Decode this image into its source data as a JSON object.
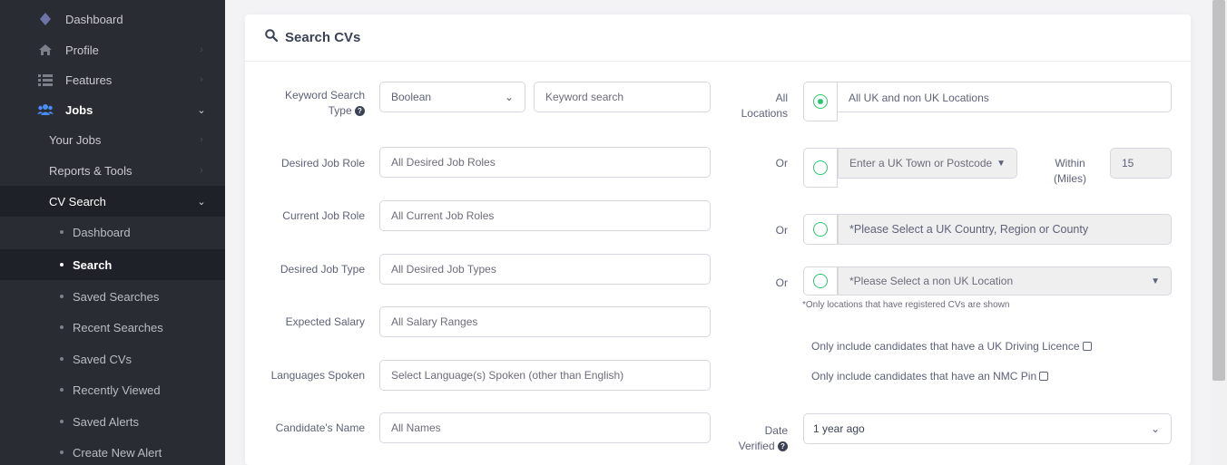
{
  "sidebar": {
    "items": [
      {
        "label": "Dashboard",
        "icon": "diamond-icon"
      },
      {
        "label": "Profile",
        "icon": "home-icon"
      },
      {
        "label": "Features",
        "icon": "list-icon"
      },
      {
        "label": "Jobs",
        "icon": "users-icon"
      },
      {
        "label": "Your Jobs"
      },
      {
        "label": "Reports & Tools"
      },
      {
        "label": "CV Search"
      }
    ],
    "sub_items": [
      {
        "label": "Dashboard"
      },
      {
        "label": "Search"
      },
      {
        "label": "Saved Searches"
      },
      {
        "label": "Recent Searches"
      },
      {
        "label": "Saved CVs"
      },
      {
        "label": "Recently Viewed"
      },
      {
        "label": "Saved Alerts"
      },
      {
        "label": "Create New Alert"
      }
    ],
    "active_sub": "Search"
  },
  "card": {
    "title": "Search CVs"
  },
  "form": {
    "keyword_type_label": "Keyword Search Type",
    "keyword_type_value": "Boolean",
    "keyword_placeholder": "Keyword search",
    "desired_job_role_label": "Desired Job Role",
    "desired_job_role_placeholder": "All Desired Job Roles",
    "current_job_role_label": "Current Job Role",
    "current_job_role_placeholder": "All Current Job Roles",
    "desired_job_type_label": "Desired Job Type",
    "desired_job_type_placeholder": "All Desired Job Types",
    "expected_salary_label": "Expected Salary",
    "expected_salary_placeholder": "All Salary Ranges",
    "languages_label": "Languages Spoken",
    "languages_placeholder": "Select Language(s) Spoken (other than English)",
    "candidate_name_label": "Candidate's Name",
    "candidate_name_placeholder": "All Names"
  },
  "location": {
    "all_locations_label": "All Locations",
    "all_locations_value": "All UK and non UK Locations",
    "or_label": "Or",
    "uk_town_placeholder": "Enter a UK Town or Postcode",
    "within_label": "Within (Miles)",
    "within_value": "15",
    "uk_region_placeholder": "*Please Select a UK Country, Region or County",
    "non_uk_placeholder": "*Please Select a non UK Location",
    "note": "*Only locations that have registered CVs are shown",
    "driving_licence_label": "Only include candidates that have a UK Driving Licence",
    "nmc_pin_label": "Only include candidates that have an NMC Pin",
    "date_verified_label": "Date Verified",
    "date_verified_value": "1 year ago"
  },
  "colors": {
    "sidebar_bg": "#2a2c34",
    "accent_green": "#28c76f",
    "page_bg": "#f3f3f6"
  }
}
